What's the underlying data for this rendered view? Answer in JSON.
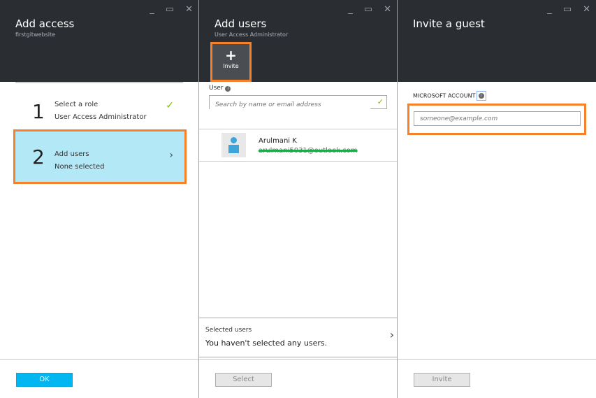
{
  "blade1": {
    "title": "Add access",
    "subtitle": "firstgitwebsite",
    "steps": [
      {
        "number": "1",
        "label": "Select a role",
        "value": "User Access Administrator"
      },
      {
        "number": "2",
        "label": "Add users",
        "value": "None selected"
      }
    ],
    "ok_label": "OK"
  },
  "blade2": {
    "title": "Add users",
    "subtitle": "User Access Administrator",
    "invite_label": "Invite",
    "user_label": "User",
    "search_placeholder": "Search by name or email address",
    "results": [
      {
        "name": "Arulmani K",
        "email": "arulmani5031@outlook.com"
      }
    ],
    "selected_label": "Selected users",
    "selected_value": "You haven't selected any users.",
    "select_label": "Select"
  },
  "blade3": {
    "title": "Invite a guest",
    "account_label": "MICROSOFT ACCOUNT",
    "email_placeholder": "someone@example.com",
    "invite_label": "Invite"
  },
  "controls": {
    "minimize": "_",
    "maximize": "▭",
    "close": "✕"
  }
}
